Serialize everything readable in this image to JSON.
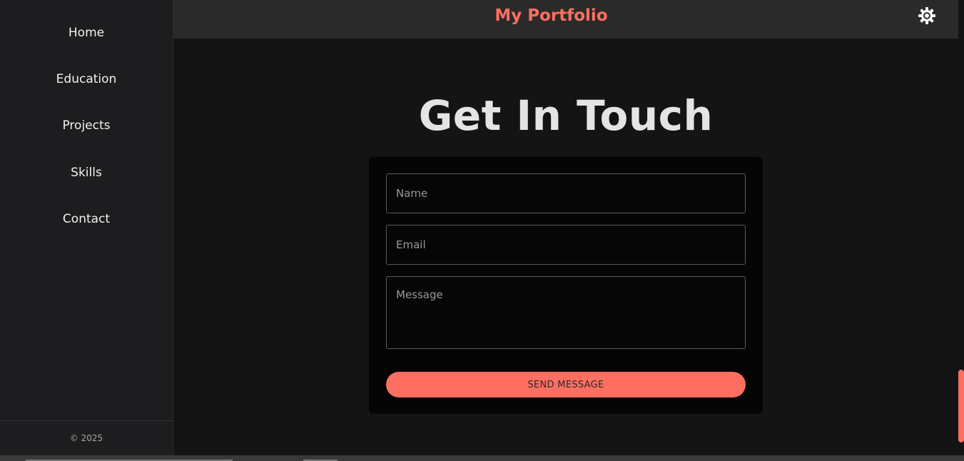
{
  "sidebar": {
    "items": [
      {
        "label": "Home"
      },
      {
        "label": "Education"
      },
      {
        "label": "Projects"
      },
      {
        "label": "Skills"
      },
      {
        "label": "Contact"
      }
    ],
    "footer": "© 2025"
  },
  "header": {
    "title": "My Portfolio",
    "theme_toggle_icon": "sun-icon"
  },
  "contact": {
    "heading": "Get In Touch",
    "name_placeholder": "Name",
    "email_placeholder": "Email",
    "message_placeholder": "Message",
    "send_label": "SEND MESSAGE"
  },
  "colors": {
    "accent": "#ff6f61",
    "background": "#141414",
    "sidebar": "#1d1d1f",
    "card": "#050505"
  }
}
